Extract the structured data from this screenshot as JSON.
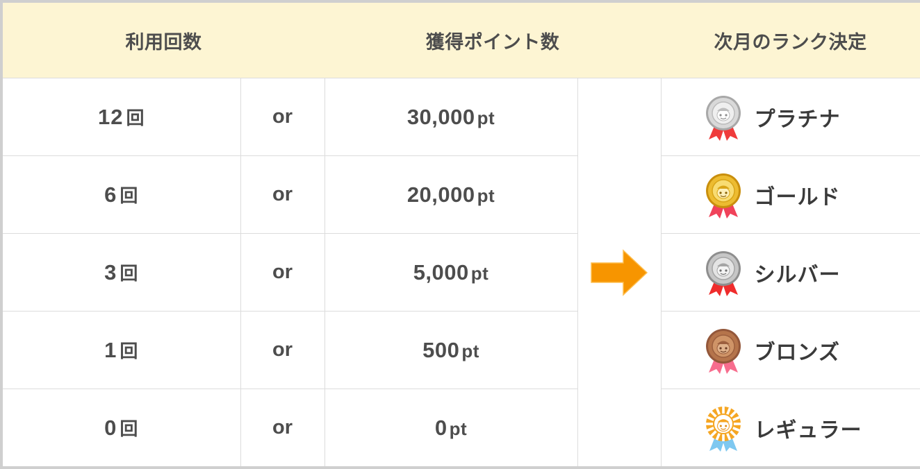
{
  "table": {
    "headers": [
      {
        "id": "usage-count",
        "label": "利用回数"
      },
      {
        "id": "points-earned",
        "label": "獲得ポイント数"
      },
      {
        "id": "next-month-rank",
        "label": "次月のランク決定"
      }
    ],
    "conjunction": "or",
    "arrow_icon": "orange-right-arrow-icon",
    "rows": [
      {
        "count": "12",
        "count_unit": "回",
        "points": "30,000",
        "points_unit": "pt",
        "rank": "プラチナ",
        "medal_icon": "platinum-medal-icon",
        "medal_colors": {
          "disc_outer": "#c9c9c9",
          "disc_inner": "#e8e8e8",
          "disc_rim": "#a8a8a8",
          "ribbon": "#e83a3a"
        }
      },
      {
        "count": "6",
        "count_unit": "回",
        "points": "20,000",
        "points_unit": "pt",
        "rank": "ゴールド",
        "medal_icon": "gold-medal-icon",
        "medal_colors": {
          "disc_outer": "#e8b21c",
          "disc_inner": "#f8dc72",
          "disc_rim": "#c98f0d",
          "ribbon": "#f0425a"
        }
      },
      {
        "count": "3",
        "count_unit": "回",
        "points": "5,000",
        "points_unit": "pt",
        "rank": "シルバー",
        "medal_icon": "silver-medal-icon",
        "medal_colors": {
          "disc_outer": "#b4b4b4",
          "disc_inner": "#dedede",
          "disc_rim": "#8e8e8e",
          "ribbon": "#ef2c2c"
        }
      },
      {
        "count": "1",
        "count_unit": "回",
        "points": "500",
        "points_unit": "pt",
        "rank": "ブロンズ",
        "medal_icon": "bronze-medal-icon",
        "medal_colors": {
          "disc_outer": "#b5744b",
          "disc_inner": "#cf9467",
          "disc_rim": "#93573a",
          "ribbon": "#f76d8e"
        }
      },
      {
        "count": "0",
        "count_unit": "回",
        "points": "0",
        "points_unit": "pt",
        "rank": "レギュラー",
        "medal_icon": "regular-rosette-icon",
        "medal_colors": {
          "disc_outer": "#f5a623",
          "disc_inner": "#ffffff",
          "disc_rim": "#e8941a",
          "ribbon": "#7ec8f0"
        }
      }
    ]
  },
  "colors": {
    "header_background": "#fdf5d3",
    "text": "#4d4d4d",
    "border": "#dcdcdc",
    "outer_border": "#cfcfcf",
    "arrow": "#f79500"
  }
}
